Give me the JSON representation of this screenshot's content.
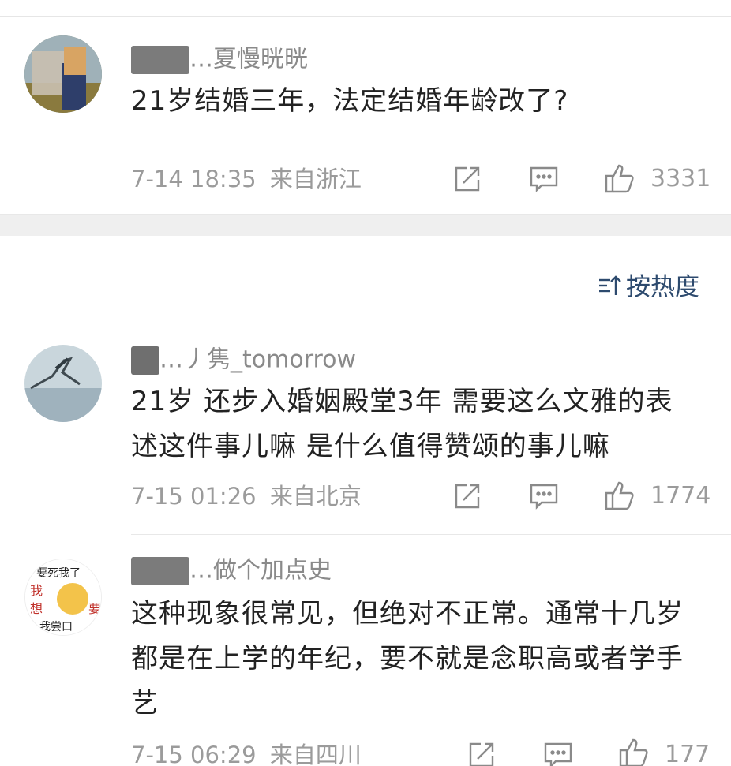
{
  "comments": [
    {
      "username": "…夏慢晄晄",
      "text": "21岁结婚三年，法定结婚年龄改了?",
      "time": "7-14 18:35",
      "location": "来自浙江",
      "likes": "3331"
    },
    {
      "username": "…丿隽_tomorrow",
      "text": "21岁 还步入婚姻殿堂3年 需要这么文雅的表述这件事儿嘛 是什么值得赞颂的事儿嘛",
      "time": "7-15 01:26",
      "location": "来自北京",
      "likes": "1774"
    },
    {
      "username": "…做个加点史",
      "text": "这种现象很常见，但绝对不正常。通常十几岁都是在上学的年纪，要不就是念职高或者学手艺",
      "time": "7-15 06:29",
      "location": "来自四川",
      "likes": "177"
    }
  ],
  "sort": {
    "label": "按热度",
    "icon": "sort-icon"
  },
  "avatar3_text": {
    "line1": "要死我了",
    "left1": "我",
    "left2": "想",
    "right": "要",
    "bottom": "我尝口"
  },
  "colors": {
    "link": "#2d4a6e",
    "meta": "#9b9b9b",
    "text": "#222222"
  }
}
